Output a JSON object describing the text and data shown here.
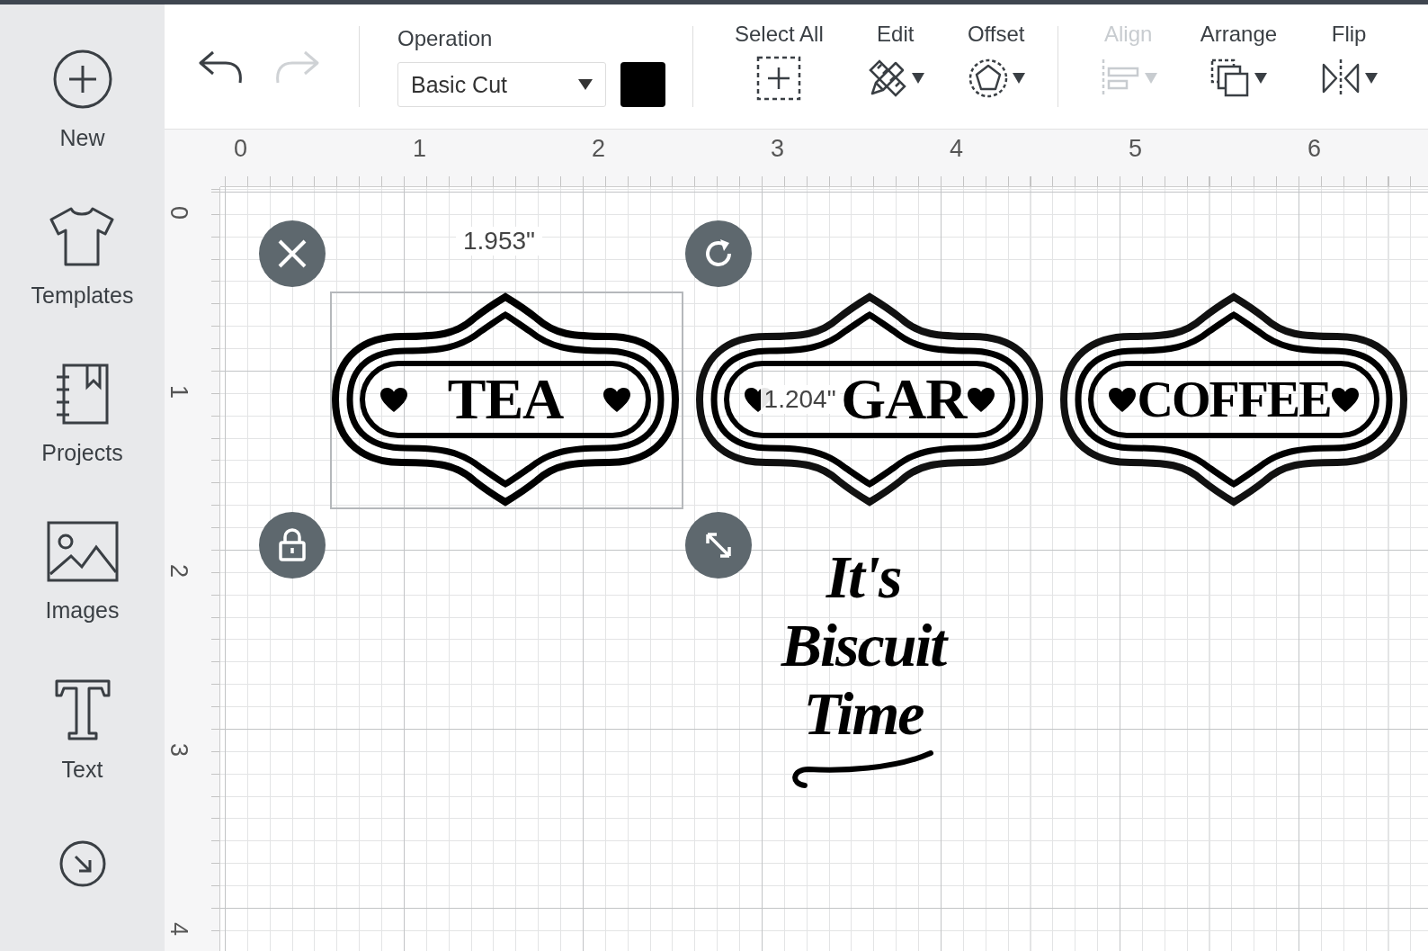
{
  "sidebar": {
    "items": [
      {
        "label": "New",
        "kind": "new"
      },
      {
        "label": "Templates",
        "kind": "templates"
      },
      {
        "label": "Projects",
        "kind": "projects"
      },
      {
        "label": "Images",
        "kind": "images"
      },
      {
        "label": "Text",
        "kind": "text"
      },
      {
        "kind": "upload"
      }
    ]
  },
  "toolbar": {
    "undo": {
      "disabled": false
    },
    "redo": {
      "disabled": true
    },
    "operation": {
      "label": "Operation",
      "value": "Basic Cut"
    },
    "tools": [
      {
        "label": "Select All",
        "kind": "select",
        "disabled": false,
        "dropdown": false
      },
      {
        "label": "Edit",
        "kind": "edit",
        "disabled": false,
        "dropdown": true
      },
      {
        "label": "Offset",
        "kind": "offset",
        "disabled": false,
        "dropdown": true
      },
      {
        "label": "Align",
        "kind": "align",
        "disabled": true,
        "dropdown": true
      },
      {
        "label": "Arrange",
        "kind": "arrange",
        "disabled": false,
        "dropdown": true
      },
      {
        "label": "Flip",
        "kind": "flip",
        "disabled": false,
        "dropdown": true
      }
    ]
  },
  "ruler": {
    "x_ticks": [
      "0",
      "1",
      "2",
      "3",
      "4",
      "5",
      "6"
    ],
    "y_ticks": [
      "0",
      "1",
      "2",
      "3",
      "4"
    ]
  },
  "canvas": {
    "selection": {
      "width_label": "1.953\""
    },
    "labels": [
      {
        "text": "TEA",
        "selected": true
      },
      {
        "text": "GAR",
        "dimension_label": "1.204\"",
        "selected": false
      },
      {
        "text": "COFFEE",
        "selected": false
      }
    ],
    "script_lines": [
      "It's",
      "Biscuit",
      "Time"
    ]
  }
}
